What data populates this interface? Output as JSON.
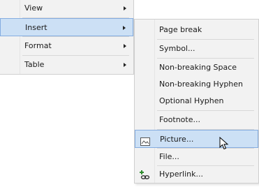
{
  "main_menu": {
    "items": [
      {
        "label": "View",
        "has_submenu": true
      },
      {
        "label": "Insert",
        "has_submenu": true,
        "highlighted": true
      },
      {
        "label": "Format",
        "has_submenu": true
      },
      {
        "label": "Table",
        "has_submenu": true
      }
    ]
  },
  "insert_submenu": {
    "page_break": "Page break",
    "symbol": "Symbol...",
    "non_breaking_space": "Non-breaking Space",
    "non_breaking_hyphen": "Non-breaking Hyphen",
    "optional_hyphen": "Optional Hyphen",
    "footnote": "Footnote...",
    "picture": "Picture...",
    "file": "File...",
    "hyperlink": "Hyperlink..."
  },
  "colors": {
    "menu_bg": "#f2f2f2",
    "highlight_bg": "#cce0f5",
    "highlight_border": "#84ace0"
  },
  "icons": {
    "picture": "picture-icon",
    "hyperlink": "hyperlink-icon",
    "cursor": "mouse-pointer-icon"
  }
}
